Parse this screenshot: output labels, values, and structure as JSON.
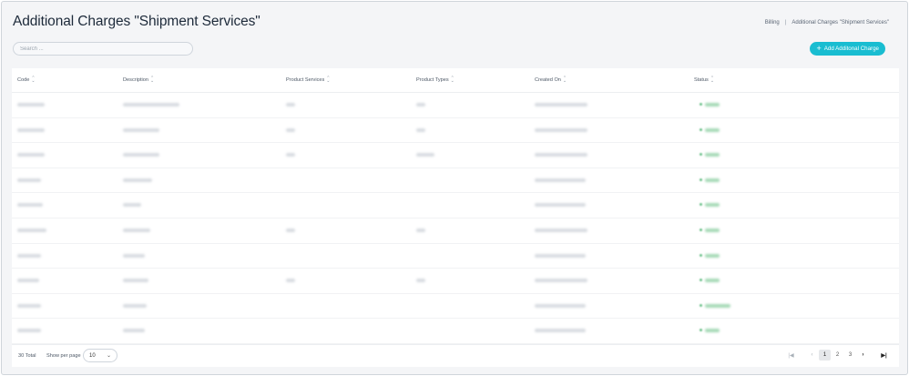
{
  "header": {
    "title": "Additional Charges \"Shipment Services\"",
    "breadcrumb": [
      "Billing",
      "|",
      "Additional Charges \"Shipment Services\""
    ]
  },
  "search": {
    "placeholder": "Search ..."
  },
  "add_button": {
    "label": "Add Additonal Charge",
    "icon": "plus-icon"
  },
  "table": {
    "columns": [
      "Code",
      "Description",
      "Product Services",
      "Product Types",
      "Created On",
      "Status"
    ],
    "row_count": 10,
    "rows_blurred": true
  },
  "footer": {
    "total": "30 Total",
    "per_page_label": "Show per page",
    "per_page_value": "10",
    "pages": [
      "1",
      "2",
      "3"
    ],
    "current_page": "1",
    "icons": [
      "first-page-icon",
      "prev-page-icon",
      "next-page-icon",
      "last-page-icon"
    ]
  },
  "colors": {
    "accent": "#19bdd1",
    "status_green": "#6cc28a"
  }
}
